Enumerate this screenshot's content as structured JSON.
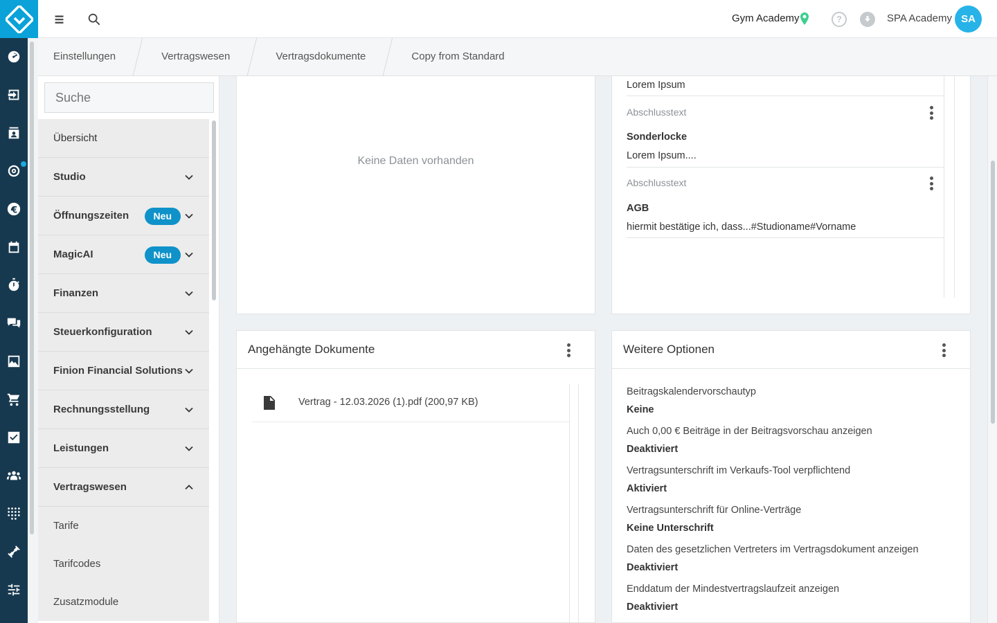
{
  "topbar": {
    "studio": "Gym Academy",
    "user_name": "SPA Academy",
    "avatar_initials": "SA",
    "help_glyph": "?"
  },
  "breadcrumb": [
    "Einstellungen",
    "Vertragswesen",
    "Vertragsdokumente",
    "Copy from Standard"
  ],
  "sidebar": {
    "search_placeholder": "Suche",
    "items": [
      {
        "label": "Übersicht"
      },
      {
        "label": "Studio"
      },
      {
        "label": "Öffnungszeiten",
        "badge": "Neu"
      },
      {
        "label": "MagicAI",
        "badge": "Neu"
      },
      {
        "label": "Finanzen"
      },
      {
        "label": "Steuerkonfiguration"
      },
      {
        "label": "Finion Financial Solutions"
      },
      {
        "label": "Rechnungsstellung"
      },
      {
        "label": "Leistungen"
      },
      {
        "label": "Vertragswesen"
      }
    ],
    "subitems": [
      "Tarife",
      "Tarifcodes",
      "Zusatzmodule"
    ]
  },
  "panel_left_top": {
    "empty_text": "Keine Daten vorhanden"
  },
  "panel_right_top": {
    "first_text": "Lorem Ipsum",
    "entries": [
      {
        "label": "Abschlusstext",
        "title": "Sonderlocke",
        "text": "Lorem Ipsum...."
      },
      {
        "label": "Abschlusstext",
        "title": "AGB",
        "text": "hiermit bestätige ich, dass...#Studioname#Vorname"
      }
    ]
  },
  "attachments": {
    "title": "Angehängte Dokumente",
    "files": [
      "Vertrag - 12.03.2026 (1).pdf (200,97 KB)"
    ]
  },
  "options": {
    "title": "Weitere Optionen",
    "items": [
      {
        "label": "Beitragskalendervorschautyp",
        "value": "Keine"
      },
      {
        "label": "Auch 0,00 € Beiträge in der Beitragsvorschau anzeigen",
        "value": "Deaktiviert"
      },
      {
        "label": "Vertragsunterschrift im Verkaufs-Tool verpflichtend",
        "value": "Aktiviert"
      },
      {
        "label": "Vertragsunterschrift für Online-Verträge",
        "value": "Keine Unterschrift"
      },
      {
        "label": "Daten des gesetzlichen Vertreters im Vertragsdokument anzeigen",
        "value": "Deaktiviert"
      },
      {
        "label": "Enddatum der Mindestvertragslaufzeit anzeigen",
        "value": "Deaktiviert"
      }
    ]
  },
  "rail_icons": [
    "dashboard-icon",
    "login-icon",
    "contacts-icon",
    "target-icon",
    "euro-icon",
    "calendar-icon",
    "stopwatch-icon",
    "chat-icon",
    "image-icon",
    "cart-icon",
    "checkbox-icon",
    "people-icon",
    "grid-dots-icon",
    "dumbbell-icon",
    "sliders-icon"
  ],
  "rail_calendar_day": "12",
  "colors": {
    "rail": "#17394f",
    "accent": "#0aa2d8",
    "badge": "#0e92c9",
    "avatar": "#27b3e8",
    "pin": "#3ecf8e"
  }
}
